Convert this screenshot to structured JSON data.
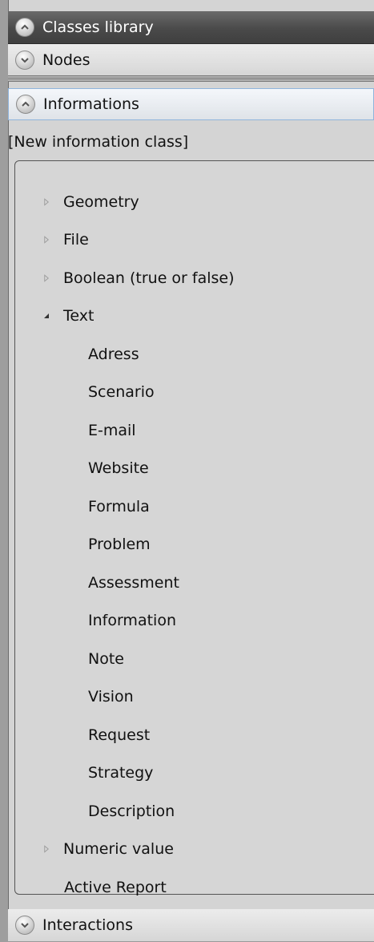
{
  "panels": {
    "classes_library": "Classes library",
    "nodes": "Nodes",
    "informations": "Informations",
    "interactions": "Interactions"
  },
  "new_class_label": "[New information class]",
  "tree": {
    "geometry": "Geometry",
    "file": "File",
    "boolean": "Boolean (true or false)",
    "text": "Text",
    "text_children": [
      "Adress",
      "Scenario",
      "E-mail",
      "Website",
      "Formula",
      "Problem",
      "Assessment",
      "Information",
      "Note",
      "Vision",
      "Request",
      "Strategy",
      "Description"
    ],
    "numeric": "Numeric value",
    "active_report": "Active Report"
  },
  "colors": {
    "selected_border": "#8fb4dc",
    "dark_header": "#4a4a4a",
    "panel_bg": "#d4d4d4"
  },
  "icons": {
    "collapse": "chevron-up-icon",
    "expand": "chevron-down-icon",
    "tree_collapsed": "triangle-right-outline-icon",
    "tree_expanded": "triangle-down-filled-icon"
  }
}
